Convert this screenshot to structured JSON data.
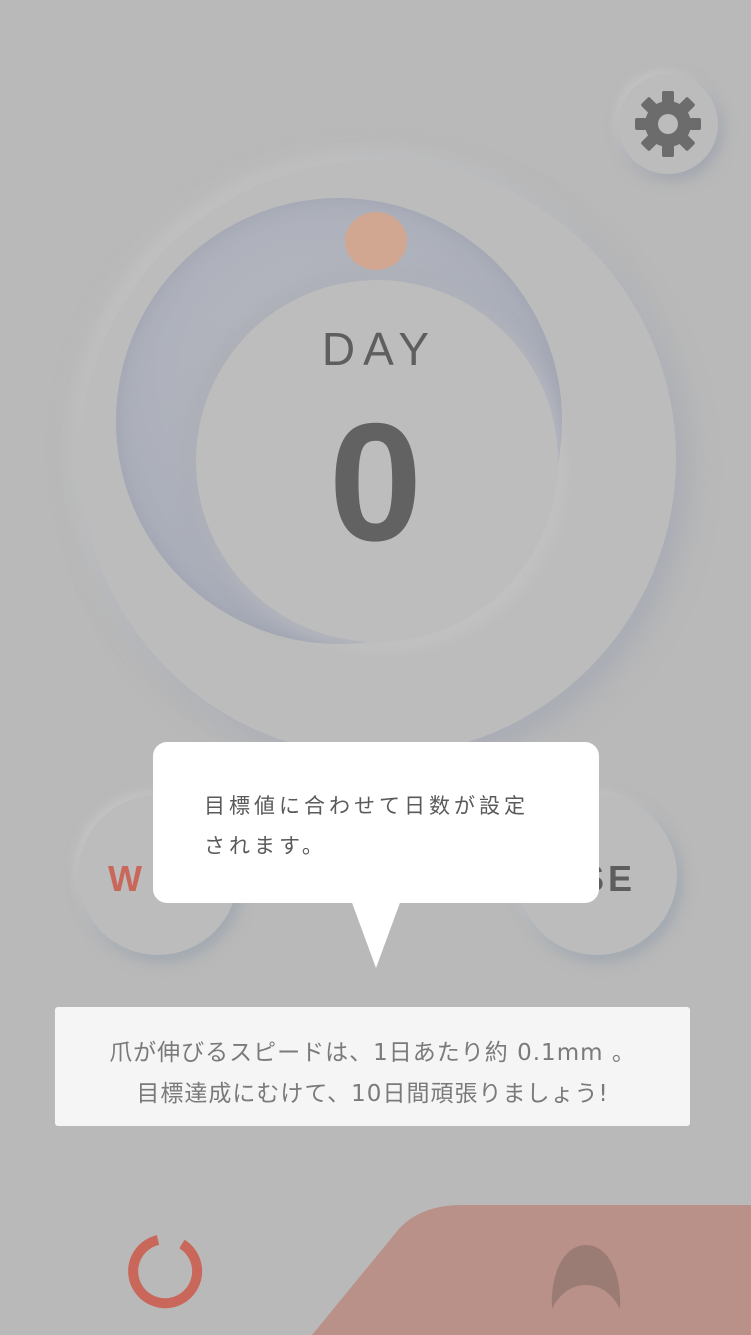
{
  "header": {
    "settings_icon": "gear-icon"
  },
  "dial": {
    "label": "DAY",
    "count": "0",
    "knob_color": "#d1a792",
    "ring_color": "#a9adb9"
  },
  "buttons": {
    "left_label": "W",
    "right_label": "SE",
    "left_color": "#c8675a"
  },
  "tooltip": {
    "line1": "目標値に合わせて日数が設定",
    "line2": "されます。"
  },
  "info": {
    "line1": "爪が伸びるスピードは、1日あたり約 0.1mm 。",
    "line2": "目標達成にむけて、10日間頑張りましょう!"
  },
  "bottom": {
    "refresh_icon": "refresh-icon",
    "nail_icon": "nail-icon",
    "accent_color": "#c8675a",
    "panel_color": "#b99189"
  }
}
